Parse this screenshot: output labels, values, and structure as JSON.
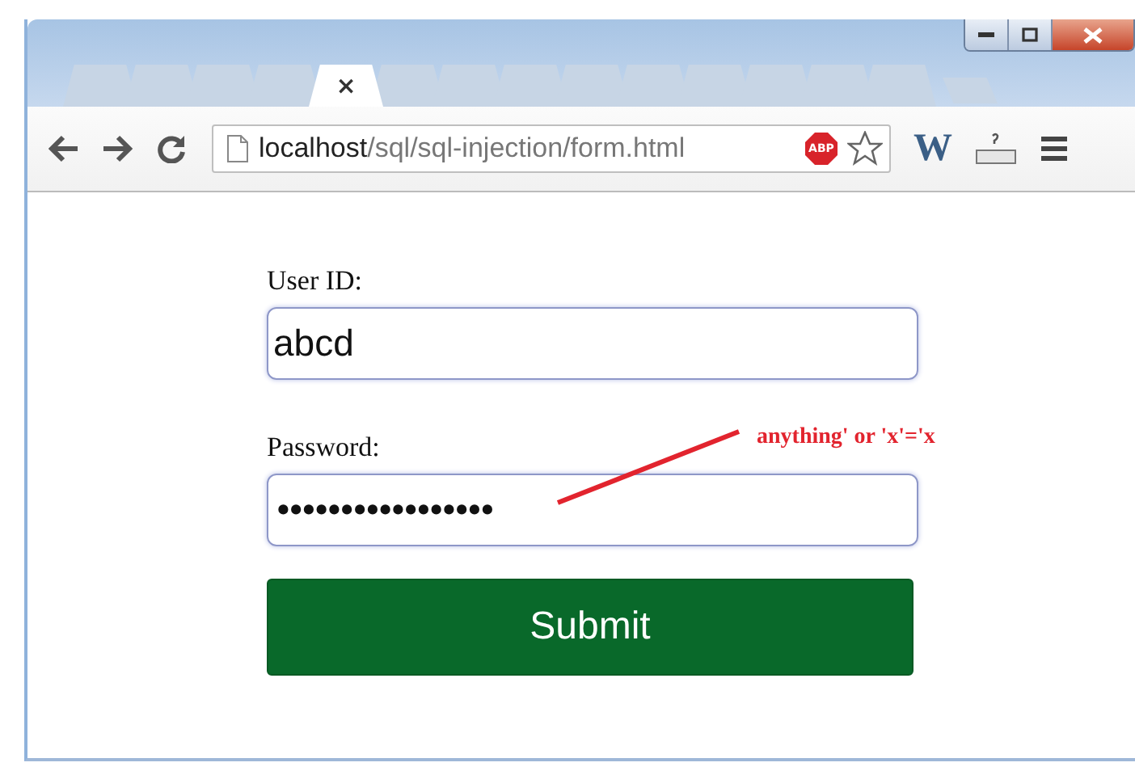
{
  "tabs": [
    {
      "selected": false
    },
    {
      "selected": false
    },
    {
      "selected": false
    },
    {
      "selected": false
    },
    {
      "selected": true
    },
    {
      "selected": false
    },
    {
      "selected": false
    },
    {
      "selected": false
    },
    {
      "selected": false
    },
    {
      "selected": false
    },
    {
      "selected": false
    },
    {
      "selected": false
    },
    {
      "selected": false
    },
    {
      "selected": false
    }
  ],
  "active_tab_close": "×",
  "address": {
    "host": "localhost",
    "path": "/sql/sql-injection/form.html"
  },
  "extensions": {
    "adblock": "ABP",
    "word": "W"
  },
  "form": {
    "fields": [
      {
        "label": "User ID:",
        "value": "abcd",
        "kind": "text"
      },
      {
        "label": "Password:",
        "value": "•••••••••••••••••",
        "kind": "password"
      }
    ],
    "submit": "Submit"
  },
  "annotation": "anything' or 'x'='x"
}
